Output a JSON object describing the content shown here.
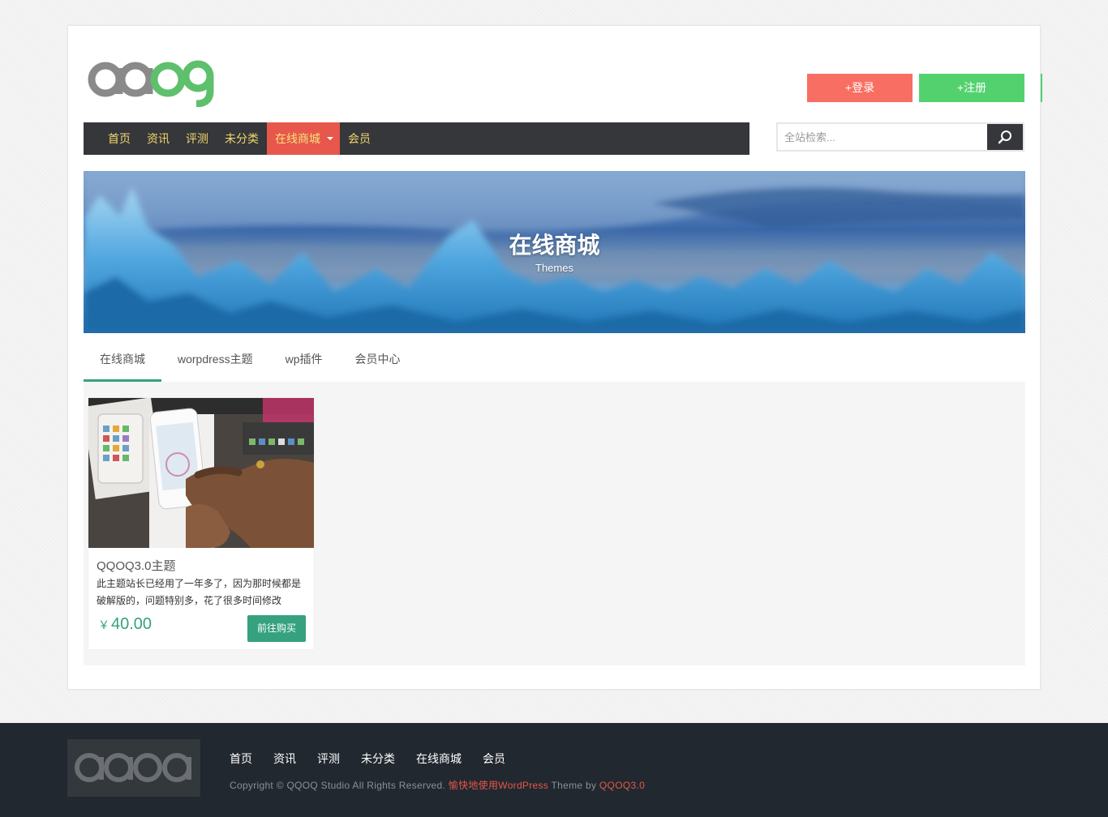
{
  "logo": {
    "text": "qqoq",
    "colors": {
      "gray": "#8a8a8a",
      "green": "#5ec06c"
    }
  },
  "auth": {
    "login_label": "+登录",
    "register_label": "+注册"
  },
  "nav": {
    "items": [
      {
        "label": "首页"
      },
      {
        "label": "资讯"
      },
      {
        "label": "评测"
      },
      {
        "label": "未分类"
      },
      {
        "label": "在线商城",
        "active": true,
        "has_dropdown": true
      },
      {
        "label": "会员"
      }
    ]
  },
  "search": {
    "placeholder": "全站检索..."
  },
  "banner": {
    "title": "在线商城",
    "subtitle": "Themes"
  },
  "tabs": [
    {
      "label": "在线商城",
      "active": true
    },
    {
      "label": "worpdress主题"
    },
    {
      "label": "wp插件"
    },
    {
      "label": "会员中心"
    }
  ],
  "products": [
    {
      "title": "QQOQ3.0主题",
      "description": "此主题站长已经用了一年多了，因为那时候都是破解版的，问题特别多，花了很多时间修改",
      "currency": "￥",
      "price": "40.00",
      "buy_label": "前往购买"
    }
  ],
  "footer": {
    "nav": [
      "首页",
      "资讯",
      "评测",
      "未分类",
      "在线商城",
      "会员"
    ],
    "copyright_prefix": "Copyright © QQOQ Studio All Rights Reserved. ",
    "wp_link": "愉快地使用WordPress",
    "theme_by": " Theme by ",
    "theme_link": "QQOQ3.0"
  },
  "colors": {
    "accent_green": "#35a17f",
    "nav_bg": "#35373b",
    "nav_active": "#e7574b",
    "login_btn": "#f96e62",
    "register_btn": "#54d16f",
    "footer_bg": "#22282f"
  }
}
